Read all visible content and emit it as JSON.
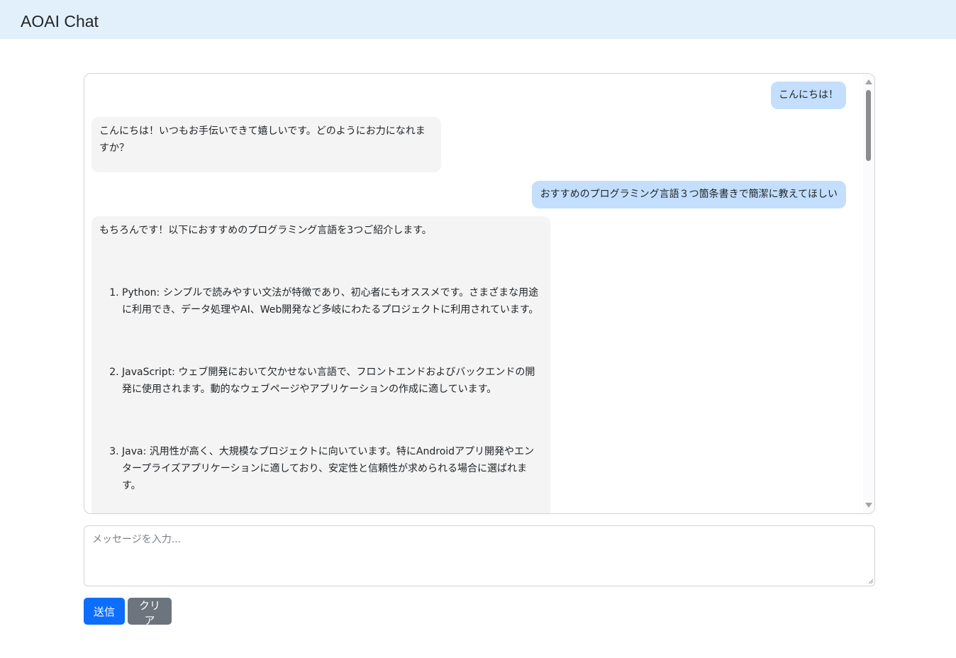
{
  "app": {
    "title": "AOAI Chat"
  },
  "messages": [
    {
      "role": "user",
      "text": "こんにちは！"
    },
    {
      "role": "assistant",
      "text": "こんにちは！いつもお手伝いできて嬉しいです。どのようにお力になれますか？"
    },
    {
      "role": "user",
      "text": "おすすめのプログラミング言語３つ箇条書きで簡潔に教えてほしい"
    },
    {
      "role": "assistant",
      "intro": "もちろんです！以下におすすめのプログラミング言語を3つご紹介します。",
      "items": [
        "Python: シンプルで読みやすい文法が特徴であり、初心者にもオススメです。さまざまな用途に利用でき、データ処理やAI、Web開発など多岐にわたるプロジェクトに利用されています。",
        "JavaScript: ウェブ開発において欠かせない言語で、フロントエンドおよびバックエンドの開発に使用されます。動的なウェブページやアプリケーションの作成に適しています。",
        "Java: 汎用性が高く、大規模なプロジェクトに向いています。特にAndroidアプリ開発やエンタープライズアプリケーションに適しており、安定性と信頼性が求められる場合に選ばれます。"
      ]
    }
  ],
  "composer": {
    "placeholder": "メッセージを入力...",
    "value": ""
  },
  "buttons": {
    "send_label": "送信",
    "clear_label": "クリア"
  },
  "colors": {
    "navbar_bg": "#e2f0fb",
    "user_bubble": "#c3dffd",
    "assistant_bubble": "#f4f4f4",
    "send_button": "#0d6efd",
    "clear_button": "#6c757d"
  }
}
